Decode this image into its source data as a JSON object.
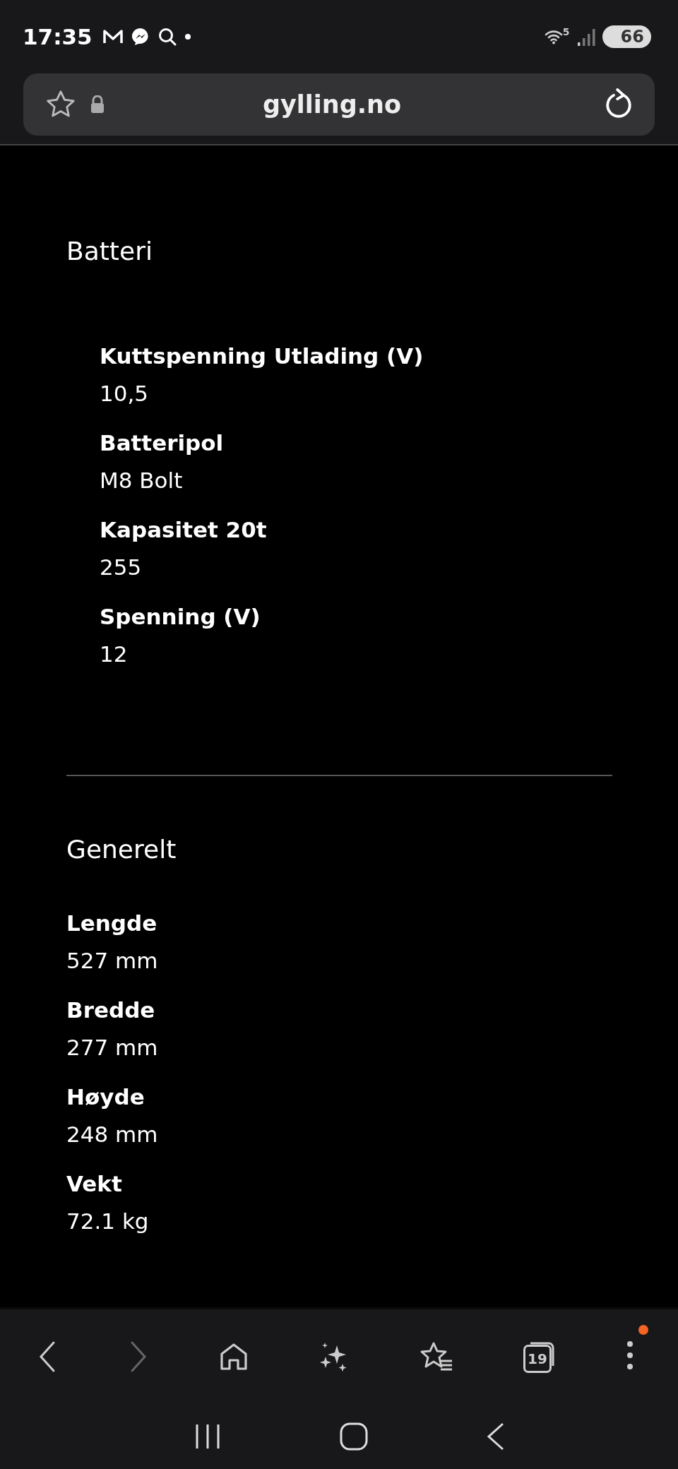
{
  "status_bar": {
    "time": "17:35",
    "wifi_label": "5",
    "battery": "66"
  },
  "address_bar": {
    "url": "gylling.no"
  },
  "sections": [
    {
      "title": "Batteri",
      "kind": "indented",
      "items": [
        {
          "label": "Kuttspenning Utlading (V)",
          "value": "10,5"
        },
        {
          "label": "Batteripol",
          "value": "M8 Bolt"
        },
        {
          "label": "Kapasitet 20t",
          "value": "255"
        },
        {
          "label": "Spenning (V)",
          "value": "12"
        }
      ]
    },
    {
      "title": "Generelt",
      "kind": "flat",
      "items": [
        {
          "label": "Lengde",
          "value": "527 mm"
        },
        {
          "label": "Bredde",
          "value": "277 mm"
        },
        {
          "label": "Høyde",
          "value": "248 mm"
        },
        {
          "label": "Vekt",
          "value": "72.1 kg"
        }
      ]
    }
  ],
  "toolbar": {
    "forward_disabled": true,
    "tabs_count": "19",
    "menu_badge": true
  }
}
